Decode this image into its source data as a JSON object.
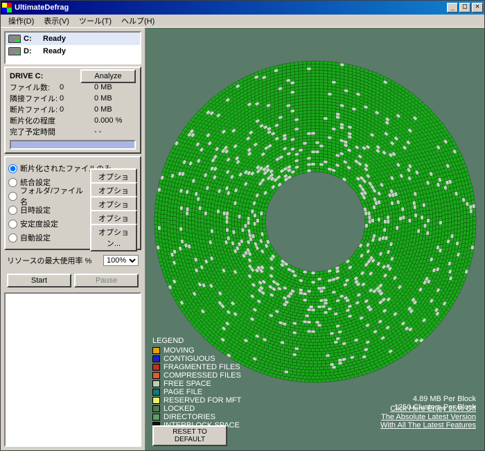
{
  "title": "UltimateDefrag",
  "menu": {
    "ops": "操作(D)",
    "view": "表示(V)",
    "tools": "ツール(T)",
    "help": "ヘルプ(H)"
  },
  "drives": [
    {
      "letter": "C:",
      "status": "Ready"
    },
    {
      "letter": "D:",
      "status": "Ready"
    }
  ],
  "info": {
    "heading": "DRIVE C:",
    "analyze": "Analyze",
    "rows": [
      {
        "label": "ファイル数:",
        "v1": "0",
        "v2": "0 MB"
      },
      {
        "label": "隣接ファイル:",
        "v1": "0",
        "v2": "0 MB"
      },
      {
        "label": "断片ファイル:",
        "v1": "0",
        "v2": "0 MB"
      },
      {
        "label": "断片化の程度",
        "v1": "",
        "v2": "0.000 %"
      },
      {
        "label": "完了予定時間",
        "v1": "",
        "v2": "- -"
      }
    ]
  },
  "radios": {
    "opt_label": "オプション...",
    "items": [
      {
        "label": "断片化されたファイルのみ",
        "checked": true,
        "btn": false
      },
      {
        "label": "統合設定",
        "checked": false,
        "btn": true
      },
      {
        "label": "フォルダ/ファイル名",
        "checked": false,
        "btn": true
      },
      {
        "label": "日時設定",
        "checked": false,
        "btn": true
      },
      {
        "label": "安定度設定",
        "checked": false,
        "btn": true
      },
      {
        "label": "自動設定",
        "checked": false,
        "btn": true
      }
    ]
  },
  "resource": {
    "label": "リソースの最大使用率 %",
    "value": "100%"
  },
  "start": "Start",
  "pause": "Pause",
  "legend": {
    "title": "LEGEND",
    "items": [
      {
        "color": "#e8a000",
        "label": "MOVING"
      },
      {
        "color": "#2020c0",
        "label": "CONTIGUOUS"
      },
      {
        "color": "#c03020",
        "label": "FRAGMENTED FILES"
      },
      {
        "color": "#e05a30",
        "label": "COMPRESSED FILES"
      },
      {
        "color": "#b8d0b8",
        "label": "FREE SPACE"
      },
      {
        "color": "#107878",
        "label": "PAGE FILE"
      },
      {
        "color": "#f0f060",
        "label": "RESERVED FOR MFT"
      },
      {
        "color": "#507850",
        "label": "LOCKED"
      },
      {
        "color": "#60a060",
        "label": "DIRECTORIES"
      },
      {
        "color": "#101010",
        "label": "INTERBLOCK SPACE"
      }
    ]
  },
  "blockinfo": {
    "l1": "4.89 MB Per Block",
    "l2": "1250 Clusters Per Block"
  },
  "promo": {
    "l1": "Click Here Enjoy 25% Off",
    "l2": "The Absolute Latest Version",
    "l3": "With All The Latest Features"
  },
  "reset": "RESET TO DEFAULT",
  "disk": {
    "colors": {
      "filled": "#1aa81a",
      "free": "#c0d8c0",
      "line": "#083008"
    },
    "outerR": 232,
    "innerR": 72,
    "rings": 36,
    "freePattern": "sparse-middle"
  }
}
